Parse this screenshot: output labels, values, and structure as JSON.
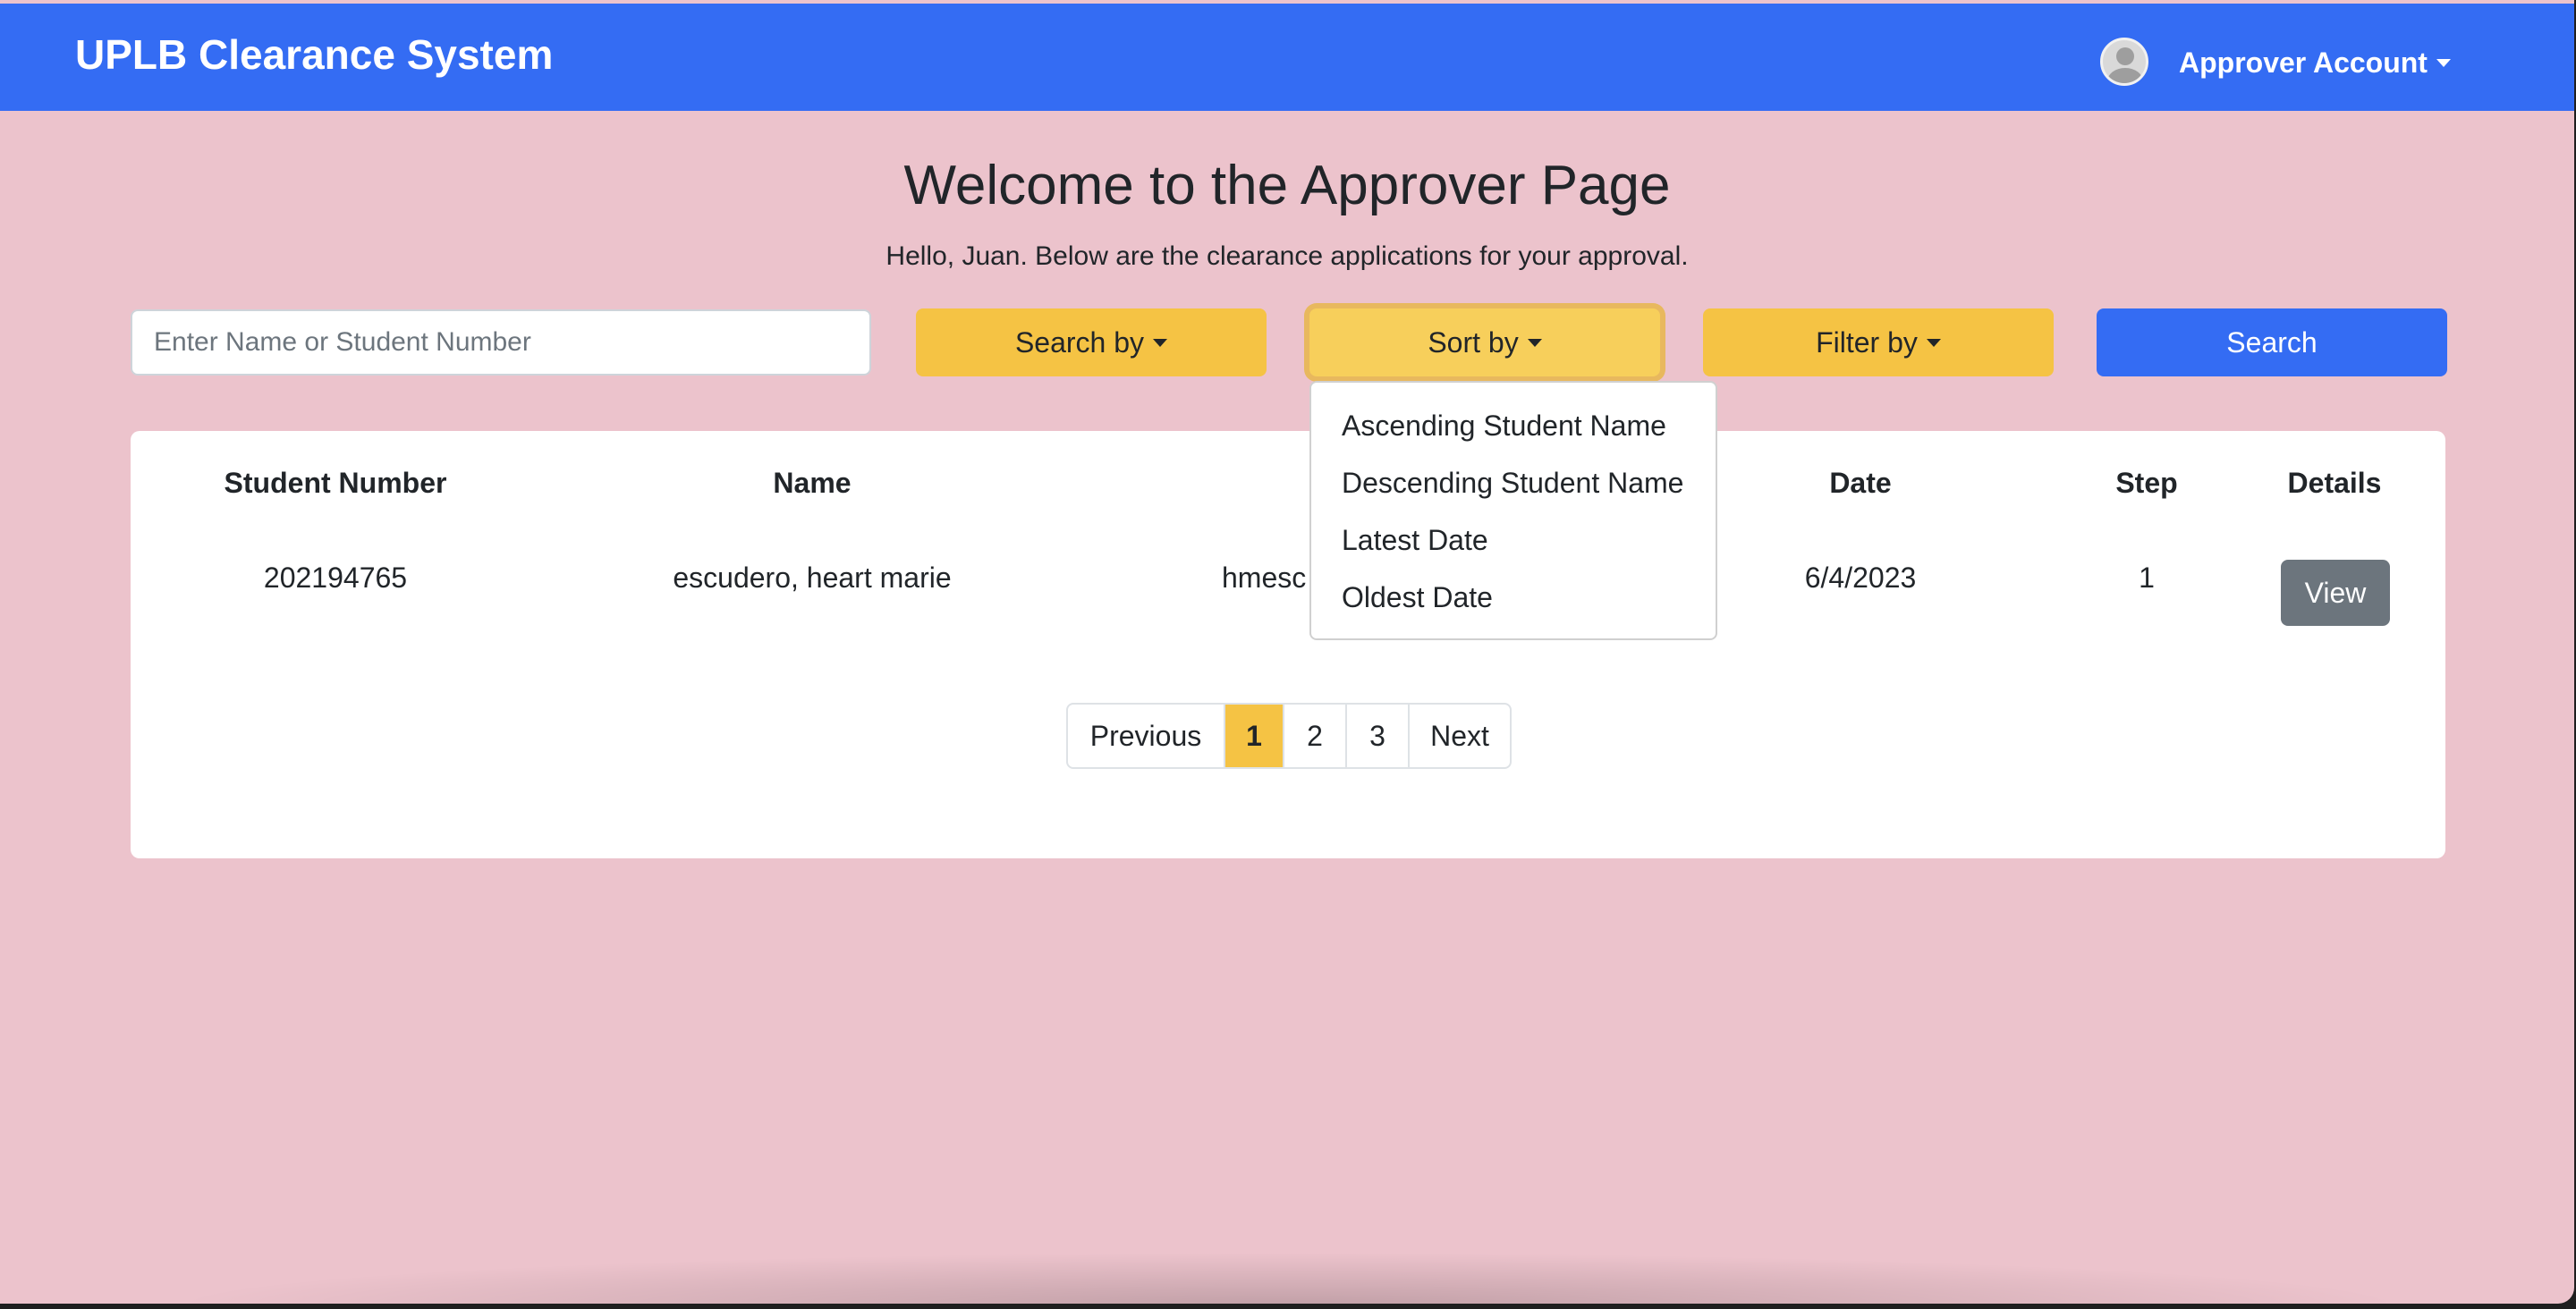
{
  "navbar": {
    "brand": "UPLB Clearance System",
    "account_label": "Approver Account"
  },
  "page": {
    "title": "Welcome to the Approver Page",
    "subtitle": "Hello, Juan. Below are the clearance applications for your approval."
  },
  "controls": {
    "search_placeholder": "Enter Name or Student Number",
    "search_by_label": "Search by",
    "sort_by_label": "Sort by",
    "filter_by_label": "Filter by",
    "search_button": "Search"
  },
  "sort_menu": {
    "items": [
      "Ascending Student Name",
      "Descending Student Name",
      "Latest Date",
      "Oldest Date"
    ]
  },
  "table": {
    "headers": [
      "Student Number",
      "Name",
      "Date",
      "Step",
      "Details"
    ],
    "rows": [
      {
        "student_number": "202194765",
        "name": "escudero, heart marie",
        "email_partial": "hmesc",
        "date": "6/4/2023",
        "step": "1",
        "action": "View"
      }
    ]
  },
  "pagination": {
    "previous": "Previous",
    "pages": [
      "1",
      "2",
      "3"
    ],
    "next": "Next",
    "current": "1"
  },
  "colors": {
    "navbar": "#346cf3",
    "background": "#ecc3cc",
    "warning": "#f5c344",
    "secondary": "#6c757d"
  }
}
